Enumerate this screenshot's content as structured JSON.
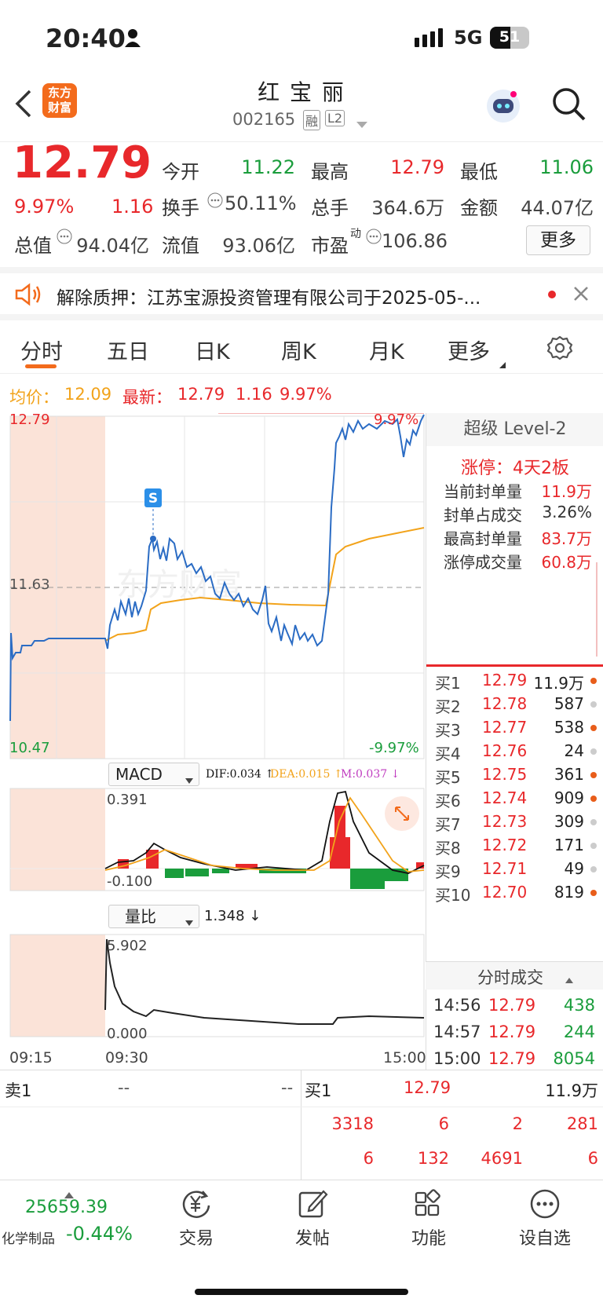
{
  "status": {
    "time": "20:40",
    "network": "5G",
    "battery": "51"
  },
  "header": {
    "name": "红 宝 丽",
    "code": "002165",
    "tag_rong": "融",
    "tag_l2": "L2",
    "logo_line1": "东方",
    "logo_line2": "财富"
  },
  "quote": {
    "price": "12.79",
    "pct": "9.97%",
    "chg": "1.16",
    "open_lbl": "今开",
    "open": "11.22",
    "high_lbl": "最高",
    "high": "12.79",
    "low_lbl": "最低",
    "low": "11.06",
    "turnover_lbl": "换手",
    "turnover": "50.11%",
    "vol_lbl": "总手",
    "vol": "364.6万",
    "amt_lbl": "金额",
    "amt": "44.07亿",
    "mcap_lbl": "总值",
    "mcap": "94.04亿",
    "float_lbl": "流值",
    "float": "93.06亿",
    "pe_lbl": "市盈",
    "pe_sup": "动",
    "pe": "106.86",
    "more": "更多"
  },
  "notice": {
    "text": "解除质押：江苏宝源投资管理有限公司于2025-05-..."
  },
  "tabs": [
    "分时",
    "五日",
    "日K",
    "周K",
    "月K",
    "更多"
  ],
  "avg": {
    "avg_lbl": "均价：",
    "avg": "12.09",
    "last_lbl": "最新：",
    "last": "12.79",
    "chg": "1.16",
    "pct": "9.97%"
  },
  "chart": {
    "top": "12.79",
    "mid": "11.63",
    "bottom": "10.47",
    "top_pct": "9.97%",
    "bottom_pct": "-9.97%",
    "watermark": "东方财富",
    "marker": "S",
    "macd_lbl": "MACD",
    "dif": "DIF:0.034 ↑",
    "dea": "DEA:0.015 ↑",
    "m": "M:0.037 ↓",
    "macd_top": "0.391",
    "macd_bottom": "-0.100",
    "vr_lbl": "量比",
    "vr": "1.348 ↓",
    "vr_top": "5.902",
    "vr_bottom": "0.000",
    "t_start": "09:15",
    "t_open": "09:30",
    "t_end": "15:00"
  },
  "l2": {
    "title": "超级 Level-2",
    "limit": "涨停：4天2板",
    "rows": [
      {
        "k": "当前封单量",
        "v": "11.9万"
      },
      {
        "k": "封单占成交",
        "v": "3.26%"
      },
      {
        "k": "最高封单量",
        "v": "83.7万"
      },
      {
        "k": "涨停成交量",
        "v": "60.8万"
      }
    ]
  },
  "orderbook": [
    {
      "lbl": "买1",
      "price": "12.79",
      "vol": "11.9万",
      "dot": "#e85d1a"
    },
    {
      "lbl": "买2",
      "price": "12.78",
      "vol": "587",
      "dot": "#ccc"
    },
    {
      "lbl": "买3",
      "price": "12.77",
      "vol": "538",
      "dot": "#e85d1a"
    },
    {
      "lbl": "买4",
      "price": "12.76",
      "vol": "24",
      "dot": "#ccc"
    },
    {
      "lbl": "买5",
      "price": "12.75",
      "vol": "361",
      "dot": "#e85d1a"
    },
    {
      "lbl": "买6",
      "price": "12.74",
      "vol": "909",
      "dot": "#e85d1a"
    },
    {
      "lbl": "买7",
      "price": "12.73",
      "vol": "309",
      "dot": "#ccc"
    },
    {
      "lbl": "买8",
      "price": "12.72",
      "vol": "171",
      "dot": "#ccc"
    },
    {
      "lbl": "买9",
      "price": "12.71",
      "vol": "49",
      "dot": "#ccc"
    },
    {
      "lbl": "买10",
      "price": "12.70",
      "vol": "819",
      "dot": "#e85d1a"
    }
  ],
  "trades": {
    "title": "分时成交",
    "rows": [
      {
        "t": "14:56",
        "p": "12.79",
        "v": "438"
      },
      {
        "t": "14:57",
        "p": "12.79",
        "v": "244"
      },
      {
        "t": "15:00",
        "p": "12.79",
        "v": "8054"
      }
    ]
  },
  "bottom": {
    "sell_lbl": "卖1",
    "sell_p": "--",
    "sell_v": "--",
    "buy_lbl": "买1",
    "buy_p": "12.79",
    "buy_v": "11.9万",
    "row2": [
      "3318",
      "6",
      "2",
      "281"
    ],
    "row3": [
      "6",
      "132",
      "4691",
      "6"
    ]
  },
  "nav": {
    "index": "25659.39",
    "sector": "化学制品",
    "sector_pct": "-0.44%",
    "items": [
      "交易",
      "发帖",
      "功能",
      "设自选"
    ]
  }
}
